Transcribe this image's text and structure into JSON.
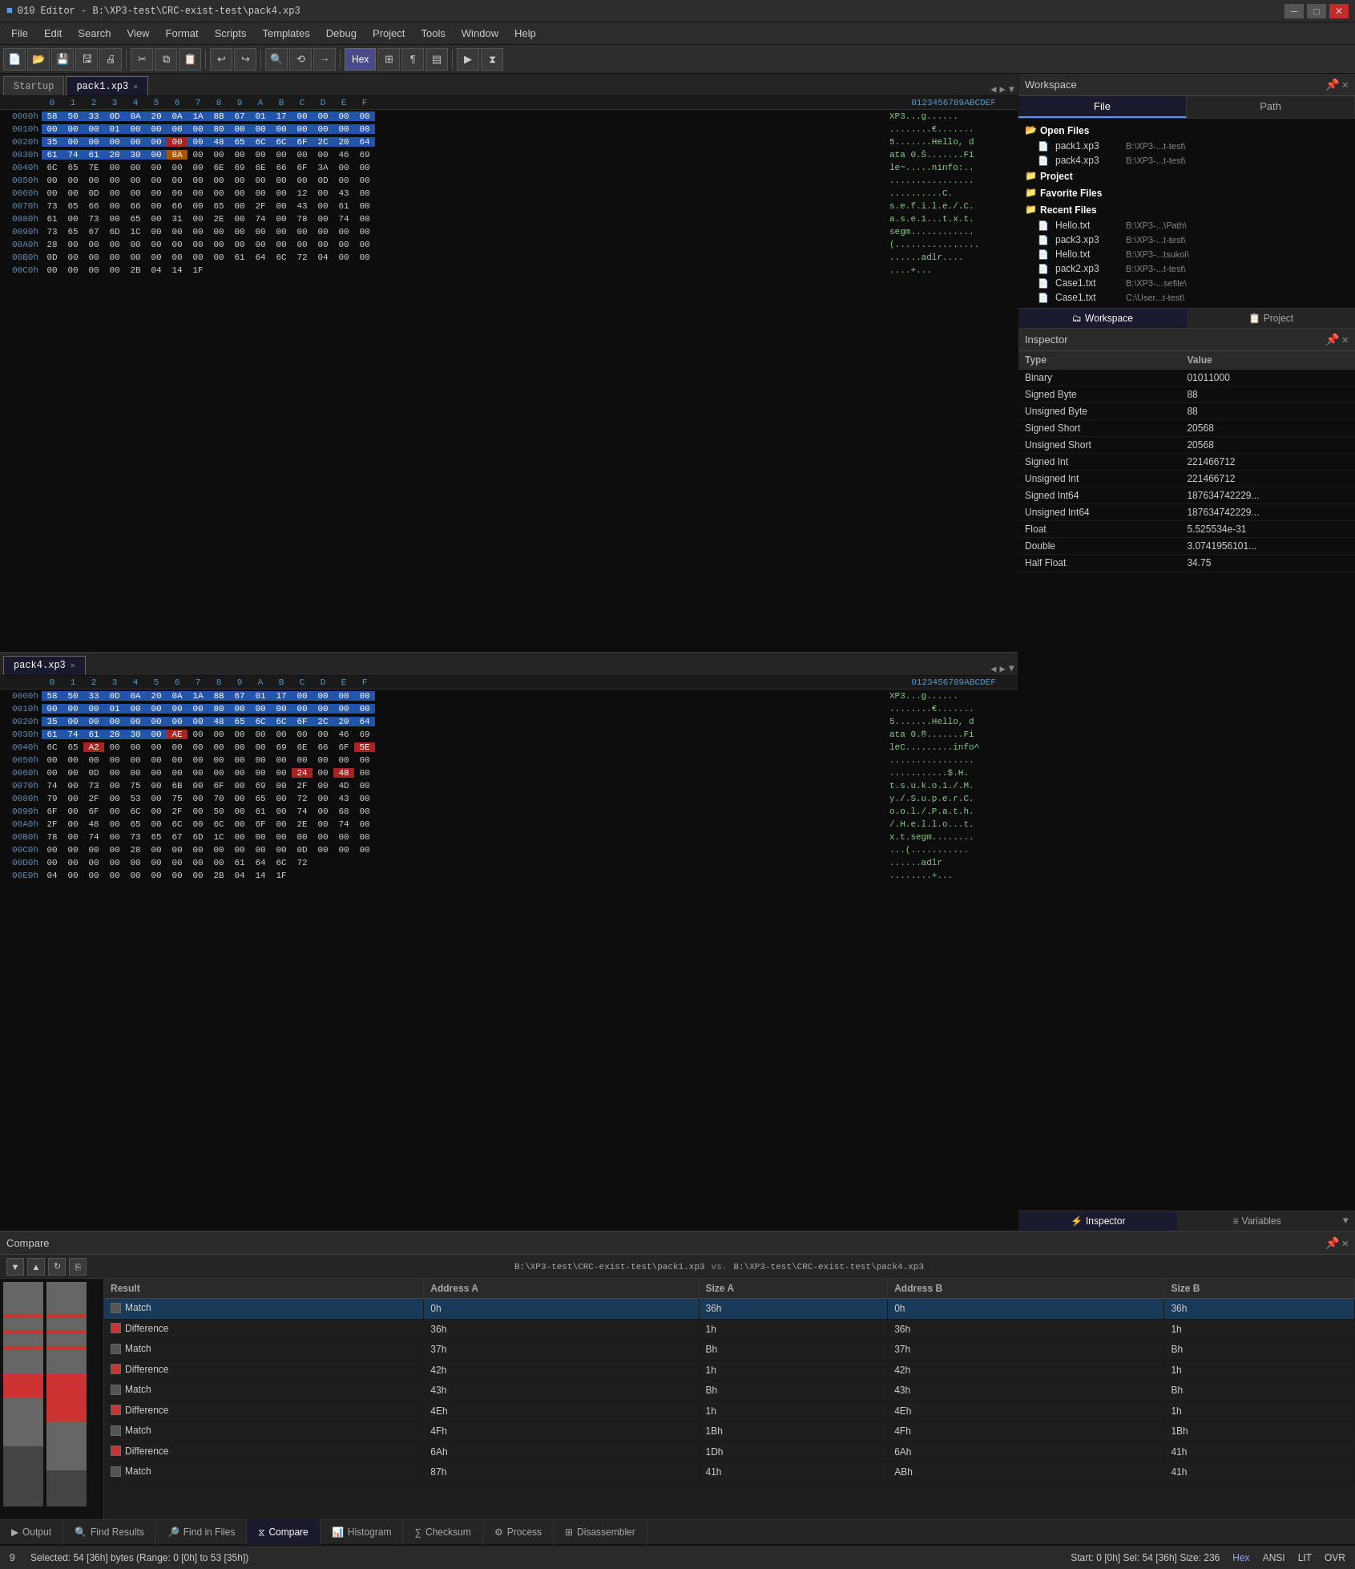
{
  "titlebar": {
    "title": "010 Editor - B:\\XP3-test\\CRC-exist-test\\pack4.xp3",
    "icon": "010-icon"
  },
  "menubar": {
    "items": [
      "File",
      "Edit",
      "Search",
      "View",
      "Format",
      "Scripts",
      "Templates",
      "Debug",
      "Project",
      "Tools",
      "Window",
      "Help"
    ]
  },
  "tabs_top": {
    "left_tab": "Startup",
    "active_tab": "pack1.xp3",
    "nav_prev": "◀",
    "nav_next": "▶",
    "nav_menu": "▼"
  },
  "tabs_bottom_editor": {
    "active_tab": "pack4.xp3"
  },
  "hex_editor_top": {
    "header_cols": [
      "0",
      "1",
      "2",
      "3",
      "4",
      "5",
      "6",
      "7",
      "8",
      "9",
      "A",
      "B",
      "C",
      "D",
      "E",
      "F"
    ],
    "ascii_header": "0123456789ABCDEF",
    "rows": [
      {
        "addr": "0000h",
        "bytes": [
          "58",
          "50",
          "33",
          "0D",
          "0A",
          "20",
          "0A",
          "1A",
          "8B",
          "67",
          "01",
          "17",
          "00",
          "00",
          "00",
          "00"
        ],
        "ascii": "XP3...g......"
      },
      {
        "addr": "0010h",
        "bytes": [
          "00",
          "00",
          "00",
          "01",
          "00",
          "00",
          "00",
          "00",
          "80",
          "00",
          "00",
          "00",
          "00",
          "00",
          "00",
          "00"
        ],
        "ascii": "........€......."
      },
      {
        "addr": "0020h",
        "bytes": [
          "35",
          "00",
          "00",
          "00",
          "00",
          "00",
          "00",
          "00",
          "48",
          "65",
          "6C",
          "6C",
          "6F",
          "2C",
          "20",
          "64"
        ],
        "ascii": "5.......Hello, d"
      },
      {
        "addr": "0030h",
        "bytes": [
          "61",
          "74",
          "61",
          "20",
          "30",
          "00",
          "8A",
          "00",
          "00",
          "00",
          "00",
          "00",
          "00",
          "00",
          "46",
          "69"
        ],
        "ascii": "ata 0.Š.......Fi"
      },
      {
        "addr": "0040h",
        "bytes": [
          "6C",
          "65",
          "7E",
          "00",
          "00",
          "00",
          "00",
          "00",
          "6E",
          "69",
          "6E",
          "66",
          "6F",
          "3A",
          "00",
          "00"
        ],
        "ascii": "le~.....ninfo:.."
      },
      {
        "addr": "0050h",
        "bytes": [
          "00",
          "00",
          "00",
          "00",
          "00",
          "00",
          "00",
          "00",
          "00",
          "00",
          "00",
          "00",
          "00",
          "0D",
          "00",
          "00"
        ],
        "ascii": "................"
      },
      {
        "addr": "0060h",
        "bytes": [
          "00",
          "00",
          "0D",
          "00",
          "00",
          "00",
          "00",
          "00",
          "00",
          "00",
          "00",
          "00",
          "12",
          "00",
          "43",
          "00"
        ],
        "ascii": "..........C."
      },
      {
        "addr": "0070h",
        "bytes": [
          "73",
          "65",
          "66",
          "00",
          "66",
          "00",
          "66",
          "00",
          "65",
          "00",
          "2F",
          "00",
          "43",
          "00",
          "61",
          "00"
        ],
        "ascii": "s.e.f.i.l.e./.C."
      },
      {
        "addr": "0080h",
        "bytes": [
          "61",
          "00",
          "73",
          "00",
          "65",
          "00",
          "31",
          "00",
          "2E",
          "00",
          "74",
          "00",
          "78",
          "00",
          "74",
          "00"
        ],
        "ascii": "a.s.e.1...t.x.t."
      },
      {
        "addr": "0090h",
        "bytes": [
          "73",
          "65",
          "67",
          "6D",
          "1C",
          "00",
          "00",
          "00",
          "00",
          "00",
          "00",
          "00",
          "00",
          "00",
          "00",
          "00"
        ],
        "ascii": "segm............"
      },
      {
        "addr": "00A0h",
        "bytes": [
          "28",
          "00",
          "00",
          "00",
          "00",
          "00",
          "00",
          "00",
          "00",
          "00",
          "00",
          "00",
          "00",
          "00",
          "00",
          "00"
        ],
        "ascii": "(................"
      },
      {
        "addr": "00B0h",
        "bytes": [
          "0D",
          "00",
          "00",
          "00",
          "00",
          "00",
          "00",
          "00",
          "00",
          "61",
          "64",
          "6C",
          "72",
          "04",
          "00",
          "00"
        ],
        "ascii": "......adlr...."
      },
      {
        "addr": "00C0h",
        "bytes": [
          "00",
          "00",
          "00",
          "00",
          "2B",
          "04",
          "14",
          "1F"
        ],
        "ascii": "....+..."
      }
    ]
  },
  "hex_editor_bottom": {
    "rows": [
      {
        "addr": "0000h",
        "bytes": [
          "58",
          "50",
          "33",
          "0D",
          "0A",
          "20",
          "0A",
          "1A",
          "8B",
          "67",
          "01",
          "17",
          "00",
          "00",
          "00",
          "00"
        ],
        "ascii": "XP3...g......"
      },
      {
        "addr": "0010h",
        "bytes": [
          "00",
          "00",
          "00",
          "01",
          "00",
          "00",
          "00",
          "00",
          "80",
          "00",
          "00",
          "00",
          "00",
          "00",
          "00",
          "00"
        ],
        "ascii": "........€......."
      },
      {
        "addr": "0020h",
        "bytes": [
          "35",
          "00",
          "00",
          "00",
          "00",
          "00",
          "00",
          "00",
          "48",
          "65",
          "6C",
          "6C",
          "6F",
          "2C",
          "20",
          "64"
        ],
        "ascii": "5.......Hello, d"
      },
      {
        "addr": "0030h",
        "bytes": [
          "61",
          "74",
          "61",
          "20",
          "30",
          "00",
          "AE",
          "00",
          "00",
          "00",
          "00",
          "00",
          "00",
          "00",
          "46",
          "69"
        ],
        "ascii": "ata 0.®.......Fi"
      },
      {
        "addr": "0040h",
        "bytes": [
          "6C",
          "65",
          "A2",
          "00",
          "00",
          "00",
          "00",
          "00",
          "00",
          "00",
          "00",
          "69",
          "6E",
          "66",
          "6F",
          "5E"
        ],
        "ascii": "leC.........info^"
      },
      {
        "addr": "0050h",
        "bytes": [
          "00",
          "00",
          "00",
          "00",
          "00",
          "00",
          "00",
          "00",
          "00",
          "00",
          "00",
          "00",
          "00",
          "00",
          "00",
          "00"
        ],
        "ascii": "................"
      },
      {
        "addr": "0060h",
        "bytes": [
          "00",
          "00",
          "0D",
          "00",
          "00",
          "00",
          "00",
          "00",
          "00",
          "00",
          "00",
          "00",
          "24",
          "00",
          "48",
          "00"
        ],
        "ascii": "...........$.H."
      },
      {
        "addr": "0070h",
        "bytes": [
          "74",
          "00",
          "73",
          "00",
          "75",
          "00",
          "6B",
          "00",
          "6F",
          "00",
          "69",
          "00",
          "2F",
          "00",
          "4D",
          "00"
        ],
        "ascii": "t.s.u.k.o.i./.M."
      },
      {
        "addr": "0080h",
        "bytes": [
          "79",
          "00",
          "2F",
          "00",
          "53",
          "00",
          "75",
          "00",
          "70",
          "00",
          "65",
          "00",
          "72",
          "00",
          "43",
          "00"
        ],
        "ascii": "y./.S.u.p.e.r.C."
      },
      {
        "addr": "0090h",
        "bytes": [
          "6F",
          "00",
          "6F",
          "00",
          "6C",
          "00",
          "2F",
          "00",
          "50",
          "00",
          "61",
          "00",
          "74",
          "00",
          "68",
          "00"
        ],
        "ascii": "o.o.l./.P.a.t.h."
      },
      {
        "addr": "00A0h",
        "bytes": [
          "2F",
          "00",
          "48",
          "00",
          "65",
          "00",
          "6C",
          "00",
          "6C",
          "00",
          "6F",
          "00",
          "2E",
          "00",
          "74",
          "00"
        ],
        "ascii": "/.H.e.l.l.o...t."
      },
      {
        "addr": "00B0h",
        "bytes": [
          "78",
          "00",
          "74",
          "00",
          "73",
          "65",
          "67",
          "6D",
          "1C",
          "00",
          "00",
          "00",
          "00",
          "00",
          "00",
          "00"
        ],
        "ascii": "x.t.segm........"
      },
      {
        "addr": "00C0h",
        "bytes": [
          "00",
          "00",
          "00",
          "00",
          "28",
          "00",
          "00",
          "00",
          "00",
          "00",
          "00",
          "00",
          "0D",
          "00",
          "00",
          "00"
        ],
        "ascii": "....(.........."
      },
      {
        "addr": "00D0h",
        "bytes": [
          "00",
          "00",
          "00",
          "00",
          "00",
          "00",
          "00",
          "00",
          "00",
          "61",
          "64",
          "6C",
          "72"
        ],
        "ascii": "......adlr"
      },
      {
        "addr": "00E0h",
        "bytes": [
          "04",
          "00",
          "00",
          "00",
          "00",
          "00",
          "00",
          "00",
          "2B",
          "04",
          "14",
          "1F"
        ],
        "ascii": "........+..."
      }
    ]
  },
  "workspace": {
    "title": "Workspace",
    "tabs": [
      "File",
      "Path"
    ],
    "active_tab": "File",
    "open_files_label": "Open Files",
    "open_files": [
      {
        "name": "pack1.xp3",
        "path": "B:\\XP3-...t-test\\"
      },
      {
        "name": "pack4.xp3",
        "path": "B:\\XP3-...t-test\\"
      }
    ],
    "project_label": "Project",
    "favorite_files_label": "Favorite Files",
    "recent_files_label": "Recent Files",
    "recent_files": [
      {
        "name": "Hello.txt",
        "path": "B:\\XP3-...\\Path\\"
      },
      {
        "name": "pack3.xp3",
        "path": "B:\\XP3-...t-test\\"
      },
      {
        "name": "Hello.txt",
        "path": "B:\\XP3-...tsukoi\\"
      },
      {
        "name": "pack2.xp3",
        "path": "B:\\XP3-...t-test\\"
      },
      {
        "name": "Case1.txt",
        "path": "B:\\XP3-...sefile\\"
      },
      {
        "name": "Case1.txt",
        "path": "C:\\User...t-test\\"
      }
    ],
    "bottom_tabs": [
      "Workspace",
      "Project"
    ]
  },
  "inspector": {
    "title": "Inspector",
    "columns": [
      "Type",
      "Value"
    ],
    "rows": [
      {
        "type": "Binary",
        "value": "01011000"
      },
      {
        "type": "Signed Byte",
        "value": "88"
      },
      {
        "type": "Unsigned Byte",
        "value": "88"
      },
      {
        "type": "Signed Short",
        "value": "20568"
      },
      {
        "type": "Unsigned Short",
        "value": "20568"
      },
      {
        "type": "Signed Int",
        "value": "221466712"
      },
      {
        "type": "Unsigned Int",
        "value": "221466712"
      },
      {
        "type": "Signed Int64",
        "value": "187634742229..."
      },
      {
        "type": "Unsigned Int64",
        "value": "187634742229..."
      },
      {
        "type": "Float",
        "value": "5.525534e-31"
      },
      {
        "type": "Double",
        "value": "3.0741956101..."
      },
      {
        "type": "Half Float",
        "value": "34.75"
      }
    ],
    "bottom_tabs": [
      "Inspector",
      "Variables"
    ],
    "more_btn": ">"
  },
  "compare": {
    "title": "Compare",
    "path_a": "B:\\XP3-test\\CRC-exist-test\\pack1.xp3",
    "vs_label": "vs.",
    "path_b": "B:\\XP3-test\\CRC-exist-test\\pack4.xp3",
    "columns": [
      "Result",
      "Address A",
      "Size A",
      "Address B",
      "Size B"
    ],
    "rows": [
      {
        "result": "Match",
        "result_type": "match",
        "addr_a": "0h",
        "size_a": "36h",
        "addr_b": "0h",
        "size_b": "36h",
        "selected": true
      },
      {
        "result": "Difference",
        "result_type": "diff",
        "addr_a": "36h",
        "size_a": "1h",
        "addr_b": "36h",
        "size_b": "1h",
        "selected": false
      },
      {
        "result": "Match",
        "result_type": "match",
        "addr_a": "37h",
        "size_a": "Bh",
        "addr_b": "37h",
        "size_b": "Bh",
        "selected": false
      },
      {
        "result": "Difference",
        "result_type": "diff",
        "addr_a": "42h",
        "size_a": "1h",
        "addr_b": "42h",
        "size_b": "1h",
        "selected": false
      },
      {
        "result": "Match",
        "result_type": "match",
        "addr_a": "43h",
        "size_a": "Bh",
        "addr_b": "43h",
        "size_b": "Bh",
        "selected": false
      },
      {
        "result": "Difference",
        "result_type": "diff",
        "addr_a": "4Eh",
        "size_a": "1h",
        "addr_b": "4Eh",
        "size_b": "1h",
        "selected": false
      },
      {
        "result": "Match",
        "result_type": "match",
        "addr_a": "4Fh",
        "size_a": "1Bh",
        "addr_b": "4Fh",
        "size_b": "1Bh",
        "selected": false
      },
      {
        "result": "Difference",
        "result_type": "diff",
        "addr_a": "6Ah",
        "size_a": "1Dh",
        "addr_b": "6Ah",
        "size_b": "41h",
        "selected": false
      },
      {
        "result": "Match",
        "result_type": "match",
        "addr_a": "87h",
        "size_a": "41h",
        "addr_b": "ABh",
        "size_b": "41h",
        "selected": false
      }
    ]
  },
  "bottom_tabs": {
    "items": [
      {
        "label": "Output",
        "icon": "output-icon"
      },
      {
        "label": "Find Results",
        "icon": "find-results-icon"
      },
      {
        "label": "Find in Files",
        "icon": "find-files-icon"
      },
      {
        "label": "Compare",
        "icon": "compare-icon",
        "active": true
      },
      {
        "label": "Histogram",
        "icon": "histogram-icon"
      },
      {
        "label": "Checksum",
        "icon": "checksum-icon"
      },
      {
        "label": "Process",
        "icon": "process-icon"
      },
      {
        "label": "Disassembler",
        "icon": "disassembler-icon"
      }
    ]
  },
  "statusbar": {
    "left": "Selected: 54 [36h] bytes (Range: 0 [0h] to 53 [35h])",
    "line_num": "9",
    "sel_info": "Start: 0 [0h]  Sel: 54 [36h]  Size: 236",
    "mode_hex": "Hex",
    "mode_ansi": "ANSI",
    "mode_lit": "LIT",
    "mode_ovr": "OVR"
  }
}
